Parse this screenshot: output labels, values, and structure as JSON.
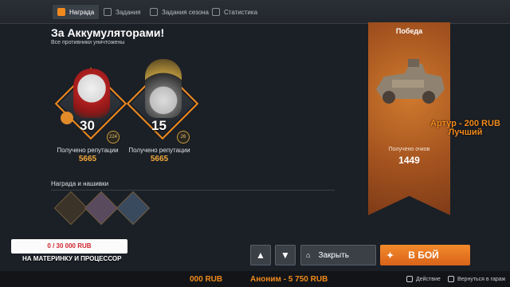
{
  "tabs": [
    {
      "label": "Награда",
      "active": true
    },
    {
      "label": "Задания",
      "active": false
    },
    {
      "label": "Задания сезона",
      "active": false
    },
    {
      "label": "Статистика",
      "active": false
    }
  ],
  "title": "За Аккумуляторами!",
  "subtitle": "Все противники уничтожены",
  "players": [
    {
      "level": "30",
      "badge_left": "",
      "badge_right": "224",
      "rep_label": "Получено репутации",
      "rep_value": "5665"
    },
    {
      "level": "15",
      "badge_left": "",
      "badge_right": "26",
      "rep_label": "Получено репутации",
      "rep_value": "5665"
    }
  ],
  "awards_label": "Награда и нашивки",
  "banner": {
    "title": "Победа",
    "score_label": "Получено очков",
    "score_value": "1449"
  },
  "donor_overlay": {
    "line1": "Артур - 200 RUB",
    "line2": "Лучший"
  },
  "donation": {
    "progress": "0 / 30 000 RUB",
    "goal": "НА МАТЕРИНКУ И ПРОЦЕССОР"
  },
  "buttons": {
    "close_label": "Закрыть",
    "fight_label": "В БОЙ"
  },
  "ticker": {
    "left": "000 RUB",
    "right": "Аноним - 5 750 RUB"
  },
  "hints": {
    "action": "Действие",
    "garage": "Вернуться в гараж"
  },
  "colors": {
    "accent": "#f08a1c",
    "banner": "#b8602a",
    "background": "#1b1f26"
  }
}
